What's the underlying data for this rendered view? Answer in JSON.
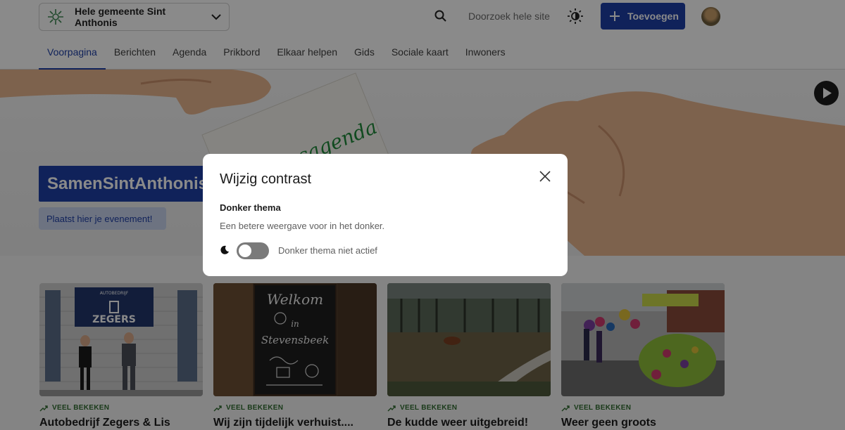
{
  "header": {
    "community": "Hele gemeente Sint Anthonis",
    "search_label": "Doorzoek hele site",
    "add_label": "Toevoegen"
  },
  "nav": {
    "items": [
      {
        "label": "Voorpagina"
      },
      {
        "label": "Berichten"
      },
      {
        "label": "Agenda"
      },
      {
        "label": "Prikbord"
      },
      {
        "label": "Elkaar helpen"
      },
      {
        "label": "Gids"
      },
      {
        "label": "Sociale kaart"
      },
      {
        "label": "Inwoners"
      }
    ],
    "active": "Voorpagina"
  },
  "hero": {
    "title": "SamenSintAnthonis",
    "cta": "Plaatst hier je evenement!",
    "card_text": "Dorpsagenda"
  },
  "cards": [
    {
      "tag": "VEEL BEKEKEN",
      "title": "Autobedrijf Zegers & Lis",
      "sign": "ZEGERS",
      "sign_small": "AUTOBEDRIJF"
    },
    {
      "tag": "VEEL BEKEKEN",
      "title": "Wij zijn tijdelijk verhuist....",
      "chalk1": "Welkom",
      "chalk2": "in",
      "chalk3": "Stevensbeek"
    },
    {
      "tag": "VEEL BEKEKEN",
      "title": "De kudde weer uitgebreid!"
    },
    {
      "tag": "VEEL BEKEKEN",
      "title": "Weer geen groots"
    }
  ],
  "modal": {
    "title": "Wijzig contrast",
    "label": "Donker thema",
    "description": "Een betere weergave voor in het donker.",
    "toggle_label": "Donker thema niet actief",
    "toggle_on": false
  },
  "colors": {
    "primary": "#1f3fa6",
    "tag_green": "#2f6b2f",
    "overlay": "rgba(0,0,0,0.46)"
  }
}
